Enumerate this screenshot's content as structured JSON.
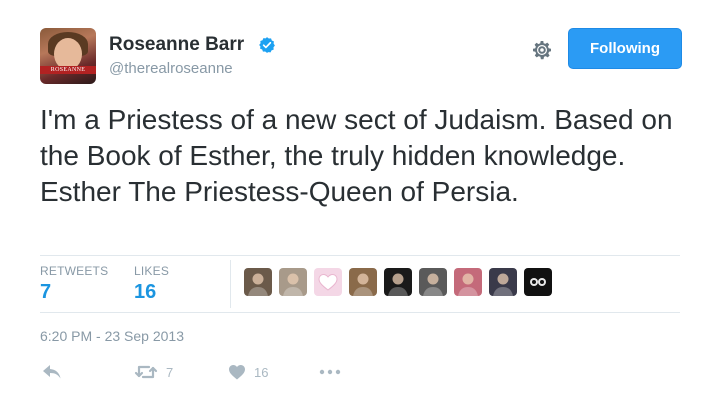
{
  "user": {
    "name": "Roseanne Barr",
    "handle": "@therealroseanne",
    "avatar_caption": "ROSEANNE"
  },
  "follow_button": {
    "label": "Following"
  },
  "tweet": {
    "text": "I'm a Priestess of a new sect of Judaism. Based on the Book of Esther, the truly hidden knowledge. Esther The Priestess-Queen of Persia."
  },
  "stats": {
    "retweets_label": "RETWEETS",
    "retweets_value": "7",
    "likes_label": "LIKES",
    "likes_value": "16"
  },
  "likers": [
    {
      "icon": "liker-avatar",
      "color": "#6b5a4a"
    },
    {
      "icon": "liker-avatar",
      "color": "#a89a8a"
    },
    {
      "icon": "liker-avatar-heart",
      "color": "#f4d7e6"
    },
    {
      "icon": "liker-avatar",
      "color": "#8a6a4a"
    },
    {
      "icon": "liker-avatar",
      "color": "#1a1a1a"
    },
    {
      "icon": "liker-avatar",
      "color": "#5a5a5a"
    },
    {
      "icon": "liker-avatar",
      "color": "#c46a7a"
    },
    {
      "icon": "liker-avatar",
      "color": "#3a3a4a"
    },
    {
      "icon": "liker-avatar-eyes",
      "color": "#111111"
    }
  ],
  "timestamp": "6:20 PM - 23 Sep 2013",
  "actions": {
    "retweet_count": "7",
    "like_count": "16"
  },
  "colors": {
    "accent": "#1b95e0",
    "button": "#2b9bf4",
    "muted": "#8899a6"
  }
}
